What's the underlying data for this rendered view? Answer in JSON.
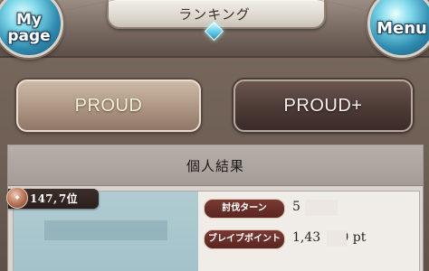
{
  "header": {
    "title": "ランキング",
    "mypage_label_line1": "My",
    "mypage_label_line2": "page",
    "menu_label": "Menu"
  },
  "tabs": [
    {
      "label": "PROUD",
      "active": true
    },
    {
      "label": "PROUD+",
      "active": false
    }
  ],
  "result": {
    "heading": "個人結果",
    "rank": "147, 7位",
    "stats": [
      {
        "label": "討伐ターン",
        "value": "5"
      },
      {
        "label": "ブレイブポイント",
        "value": "1,43   00 pt"
      }
    ]
  },
  "colors": {
    "active_tab_text": "#f4f0d4",
    "inactive_tab_text": "#f6f1ec",
    "stat_label_bg": "#6a2f29",
    "card_left_bg": "#a8c5cd"
  }
}
